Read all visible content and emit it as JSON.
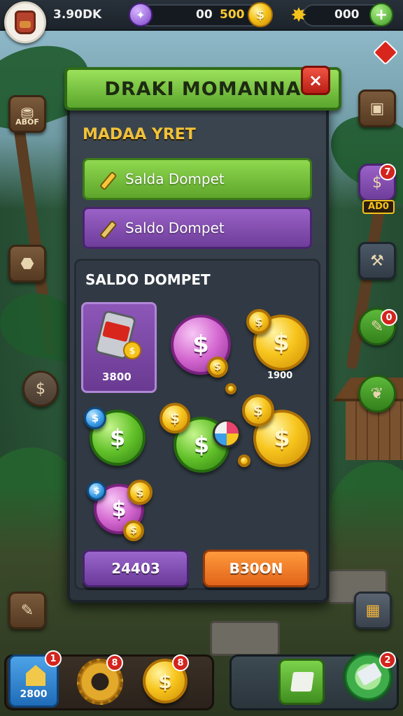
{
  "top_bar": {
    "player_value": "3.90DK",
    "counter_a": "00",
    "gold_value": "500",
    "counter_b": "000",
    "add_label": "+"
  },
  "dialog": {
    "title": "DRAKI MOMANNA",
    "close_label": "×",
    "section_label": "MADAA YRET",
    "options": [
      {
        "label": "Salda Dompet",
        "color": "#6fbf3a"
      },
      {
        "label": "Saldo Dompet",
        "color": "#8a52b8"
      }
    ],
    "wallet": {
      "title": "SALDO DOMPET",
      "item_value": "3800",
      "coin_value": "1900",
      "coin_symbol": "$"
    },
    "buttons": {
      "left_label": "24403",
      "right_label": "B30ON"
    }
  },
  "side_left": {
    "top_label": "ABOF"
  },
  "side_right": {
    "badge_1": "7",
    "price_tag": "AD0",
    "badge_2": "0"
  },
  "bottom_bar": {
    "home_label": "2800",
    "home_badge": "1",
    "gear_badge": "8",
    "coin_badge": "8",
    "burst_badge": "2"
  },
  "colors": {
    "accent_green": "#5aa52d",
    "accent_purple": "#6e3d9a",
    "accent_orange": "#e1641a",
    "gold": "#f7c51d"
  }
}
